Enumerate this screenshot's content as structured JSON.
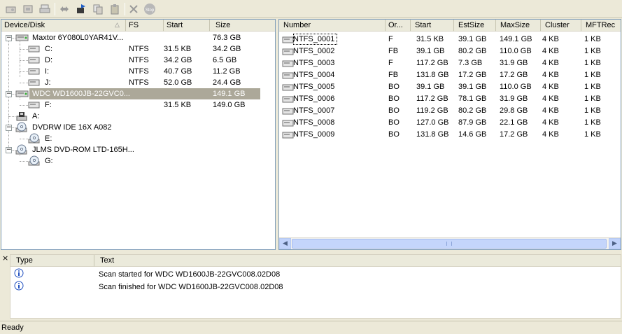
{
  "toolbar": {
    "buttons": [
      "open-disk-icon",
      "save-image-icon",
      "print-icon",
      "swap-icon",
      "export-icon",
      "copy-icon",
      "paste-icon",
      "cancel-icon",
      "stop-icon"
    ],
    "stop_label": "Stop"
  },
  "tree": {
    "columns": {
      "device": "Device/Disk",
      "fs": "FS",
      "start": "Start",
      "size": "Size"
    },
    "rows": [
      {
        "name": "Maxtor 6Y080L0YAR41V...",
        "fs": "",
        "start": "",
        "size": "76.3 GB"
      },
      {
        "name": "C:",
        "fs": "NTFS",
        "start": "31.5 KB",
        "size": "34.2 GB"
      },
      {
        "name": "D:",
        "fs": "NTFS",
        "start": "34.2 GB",
        "size": "6.5 GB"
      },
      {
        "name": "I:",
        "fs": "NTFS",
        "start": "40.7 GB",
        "size": "11.2 GB"
      },
      {
        "name": "J:",
        "fs": "NTFS",
        "start": "52.0 GB",
        "size": "24.4 GB"
      },
      {
        "name": "WDC WD1600JB-22GVC0...",
        "fs": "",
        "start": "",
        "size": "149.1 GB"
      },
      {
        "name": "F:",
        "fs": "",
        "start": "31.5 KB",
        "size": "149.0 GB"
      },
      {
        "name": "A:",
        "fs": "",
        "start": "",
        "size": ""
      },
      {
        "name": "DVDRW IDE 16X A082",
        "fs": "",
        "start": "",
        "size": ""
      },
      {
        "name": "E:",
        "fs": "",
        "start": "",
        "size": ""
      },
      {
        "name": "JLMS DVD-ROM LTD-165H...",
        "fs": "",
        "start": "",
        "size": ""
      },
      {
        "name": "G:",
        "fs": "",
        "start": "",
        "size": ""
      }
    ]
  },
  "partitions": {
    "columns": {
      "number": "Number",
      "or": "Or...",
      "start": "Start",
      "estsize": "EstSize",
      "maxsize": "MaxSize",
      "cluster": "Cluster",
      "mftrec": "MFTRec"
    },
    "rows": [
      {
        "number": "NTFS_0001",
        "or": "F",
        "start": "31.5 KB",
        "estsize": "39.1 GB",
        "maxsize": "149.1 GB",
        "cluster": "4 KB",
        "mftrec": "1 KB"
      },
      {
        "number": "NTFS_0002",
        "or": "FB",
        "start": "39.1 GB",
        "estsize": "80.2 GB",
        "maxsize": "110.0 GB",
        "cluster": "4 KB",
        "mftrec": "1 KB"
      },
      {
        "number": "NTFS_0003",
        "or": "F",
        "start": "117.2 GB",
        "estsize": "7.3 GB",
        "maxsize": "31.9 GB",
        "cluster": "4 KB",
        "mftrec": "1 KB"
      },
      {
        "number": "NTFS_0004",
        "or": "FB",
        "start": "131.8 GB",
        "estsize": "17.2 GB",
        "maxsize": "17.2 GB",
        "cluster": "4 KB",
        "mftrec": "1 KB"
      },
      {
        "number": "NTFS_0005",
        "or": "BO",
        "start": "39.1 GB",
        "estsize": "39.1 GB",
        "maxsize": "110.0 GB",
        "cluster": "4 KB",
        "mftrec": "1 KB"
      },
      {
        "number": "NTFS_0006",
        "or": "BO",
        "start": "117.2 GB",
        "estsize": "78.1 GB",
        "maxsize": "31.9 GB",
        "cluster": "4 KB",
        "mftrec": "1 KB"
      },
      {
        "number": "NTFS_0007",
        "or": "BO",
        "start": "119.2 GB",
        "estsize": "80.2 GB",
        "maxsize": "29.8 GB",
        "cluster": "4 KB",
        "mftrec": "1 KB"
      },
      {
        "number": "NTFS_0008",
        "or": "BO",
        "start": "127.0 GB",
        "estsize": "87.9 GB",
        "maxsize": "22.1 GB",
        "cluster": "4 KB",
        "mftrec": "1 KB"
      },
      {
        "number": "NTFS_0009",
        "or": "BO",
        "start": "131.8 GB",
        "estsize": "14.6 GB",
        "maxsize": "17.2 GB",
        "cluster": "4 KB",
        "mftrec": "1 KB"
      }
    ]
  },
  "log": {
    "close_glyph": "×",
    "columns": {
      "type": "Type",
      "text": "Text"
    },
    "rows": [
      {
        "icon": "info-icon",
        "text": "Scan started for WDC WD1600JB-22GVC008.02D08"
      },
      {
        "icon": "info-icon",
        "text": "Scan finished for WDC WD1600JB-22GVC008.02D08"
      }
    ]
  },
  "status": {
    "text": "Ready"
  },
  "colors": {
    "selection": "#aca899",
    "border": "#7f9db9",
    "scroll": "#c1d3fb"
  }
}
